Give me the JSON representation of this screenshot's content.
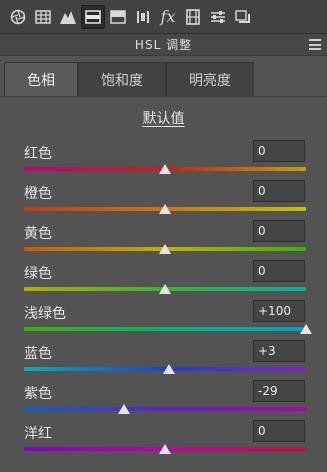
{
  "toolbar": {
    "icons": [
      "aperture-icon",
      "grid-icon",
      "mountain-icon",
      "hsl-icon",
      "split-icon",
      "detail-icon",
      "fx-icon",
      "film-icon",
      "sliders-icon",
      "presets-icon"
    ],
    "active_index": 3,
    "fx_label": "fx"
  },
  "panel": {
    "title": "HSL 调整"
  },
  "tabs": [
    {
      "label": "色相",
      "active": true
    },
    {
      "label": "饱和度",
      "active": false
    },
    {
      "label": "明亮度",
      "active": false
    }
  ],
  "default_label": "默认值",
  "sliders": [
    {
      "label": "红色",
      "value": "0",
      "fraction": 0.5,
      "gradient": [
        "#c2007a",
        "#c22020",
        "#c2a000"
      ]
    },
    {
      "label": "橙色",
      "value": "0",
      "fraction": 0.5,
      "gradient": [
        "#c23a1a",
        "#c27a10",
        "#c2c200"
      ]
    },
    {
      "label": "黄色",
      "value": "0",
      "fraction": 0.5,
      "gradient": [
        "#c25a00",
        "#c2b000",
        "#3cb000"
      ]
    },
    {
      "label": "绿色",
      "value": "0",
      "fraction": 0.5,
      "gradient": [
        "#b0b000",
        "#3cb030",
        "#00b0a0"
      ]
    },
    {
      "label": "浅绿色",
      "value": "+100",
      "fraction": 1.0,
      "gradient": [
        "#3cb000",
        "#00b070",
        "#00a0c8"
      ]
    },
    {
      "label": "蓝色",
      "value": "+3",
      "fraction": 0.515,
      "gradient": [
        "#00b0b0",
        "#2040c8",
        "#8020c8"
      ]
    },
    {
      "label": "紫色",
      "value": "-29",
      "fraction": 0.355,
      "gradient": [
        "#1060c8",
        "#6020c8",
        "#b000b0"
      ]
    },
    {
      "label": "洋红",
      "value": "0",
      "fraction": 0.5,
      "gradient": [
        "#8000c8",
        "#c000a0",
        "#c01040"
      ]
    }
  ]
}
